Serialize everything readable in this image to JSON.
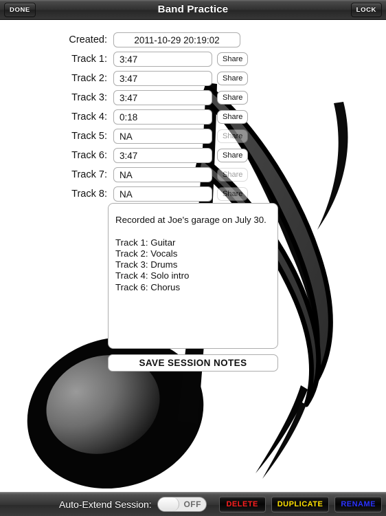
{
  "topbar": {
    "title": "Band Practice",
    "done_label": "DONE",
    "lock_label": "LOCK"
  },
  "form": {
    "created_label": "Created:",
    "created_value": "2011-10-29 20:19:02",
    "share_label": "Share",
    "tracks": [
      {
        "label": "Track 1:",
        "value": "3:47",
        "share_enabled": true
      },
      {
        "label": "Track 2:",
        "value": "3:47",
        "share_enabled": true
      },
      {
        "label": "Track 3:",
        "value": "3:47",
        "share_enabled": true
      },
      {
        "label": "Track 4:",
        "value": "0:18",
        "share_enabled": true
      },
      {
        "label": "Track 5:",
        "value": "NA",
        "share_enabled": false
      },
      {
        "label": "Track 6:",
        "value": "3:47",
        "share_enabled": true
      },
      {
        "label": "Track 7:",
        "value": "NA",
        "share_enabled": false
      },
      {
        "label": "Track 8:",
        "value": "NA",
        "share_enabled": false
      }
    ]
  },
  "notes": {
    "text": "Recorded at Joe's garage on July 30.\n\nTrack 1: Guitar\nTrack 2: Vocals\nTrack 3: Drums\nTrack 4: Solo intro\nTrack 6: Chorus",
    "save_label": "SAVE SESSION NOTES"
  },
  "bottombar": {
    "auto_extend_label": "Auto-Extend Session:",
    "toggle_state": "OFF",
    "delete_label": "DELETE",
    "duplicate_label": "DUPLICATE",
    "rename_label": "RENAME"
  },
  "colors": {
    "delete": "#ff1f1f",
    "duplicate": "#ffe000",
    "rename": "#2b33ff",
    "note_fill": "#000000",
    "note_flag": "#3a3a3a",
    "note_highlight": "#8f8f8f"
  }
}
